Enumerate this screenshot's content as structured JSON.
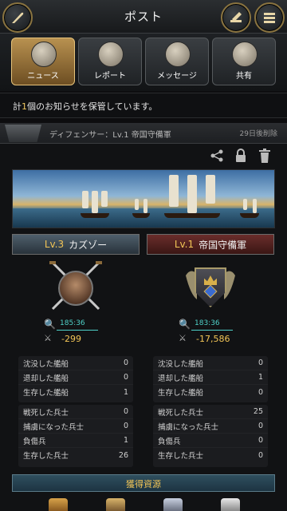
{
  "header": {
    "title": "ポスト",
    "back_icon": "quill-icon",
    "compose_icon": "compose-icon",
    "list_icon": "list-icon"
  },
  "tabs": [
    {
      "label": "ニュース",
      "icon": "newspaper-icon",
      "active": true
    },
    {
      "label": "レポート",
      "icon": "crossed-swords-icon",
      "active": false
    },
    {
      "label": "メッセージ",
      "icon": "envelope-icon",
      "active": false
    },
    {
      "label": "共有",
      "icon": "share-quill-icon",
      "active": false
    }
  ],
  "notice": {
    "prefix": "計",
    "count": "1",
    "suffix": "個のお知らせを保管しています。"
  },
  "mail": {
    "subject": "ディフェンサー：Lv.1 帝国守備軍",
    "delete_in": "29日後削除"
  },
  "attacker": {
    "level": "Lv.3",
    "name": "カズゾー",
    "coord": "185:36",
    "power": "-299",
    "ships": [
      {
        "label": "沈没した艦船",
        "value": "0"
      },
      {
        "label": "退却した艦船",
        "value": "0"
      },
      {
        "label": "生存した艦船",
        "value": "1"
      }
    ],
    "troops": [
      {
        "label": "戦死した兵士",
        "value": "0"
      },
      {
        "label": "捕虜になった兵士",
        "value": "0"
      },
      {
        "label": "負傷兵",
        "value": "1"
      },
      {
        "label": "生存した兵士",
        "value": "26"
      }
    ]
  },
  "defender": {
    "level": "Lv.1",
    "name": "帝国守備軍",
    "coord": "183:36",
    "power": "-17,586",
    "ships": [
      {
        "label": "沈没した艦船",
        "value": "0"
      },
      {
        "label": "退却した艦船",
        "value": "1"
      },
      {
        "label": "生存した艦船",
        "value": "0"
      }
    ],
    "troops": [
      {
        "label": "戦死した兵士",
        "value": "25"
      },
      {
        "label": "捕虜になった兵士",
        "value": "0"
      },
      {
        "label": "負傷兵",
        "value": "0"
      },
      {
        "label": "生存した兵士",
        "value": "0"
      }
    ]
  },
  "rewards": {
    "title": "獲得資源"
  },
  "colors": {
    "accent_gold": "#f2c556",
    "coord_teal": "#4fd0c8",
    "attacker_head": "#3a4853",
    "defender_head": "#4f201e"
  }
}
